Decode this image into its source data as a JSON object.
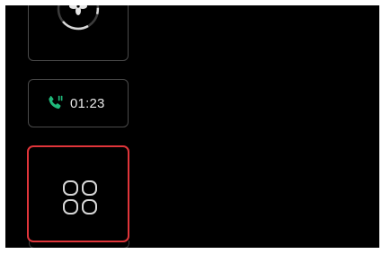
{
  "fan_tile": {
    "icon": "fan-icon"
  },
  "call_tile": {
    "icon": "phone-call-icon",
    "duration": "01:23",
    "icon_color": "#1fb87a"
  },
  "apps_tile": {
    "icon": "app-grid-icon",
    "selected": true,
    "highlight_color": "#e0353a"
  }
}
